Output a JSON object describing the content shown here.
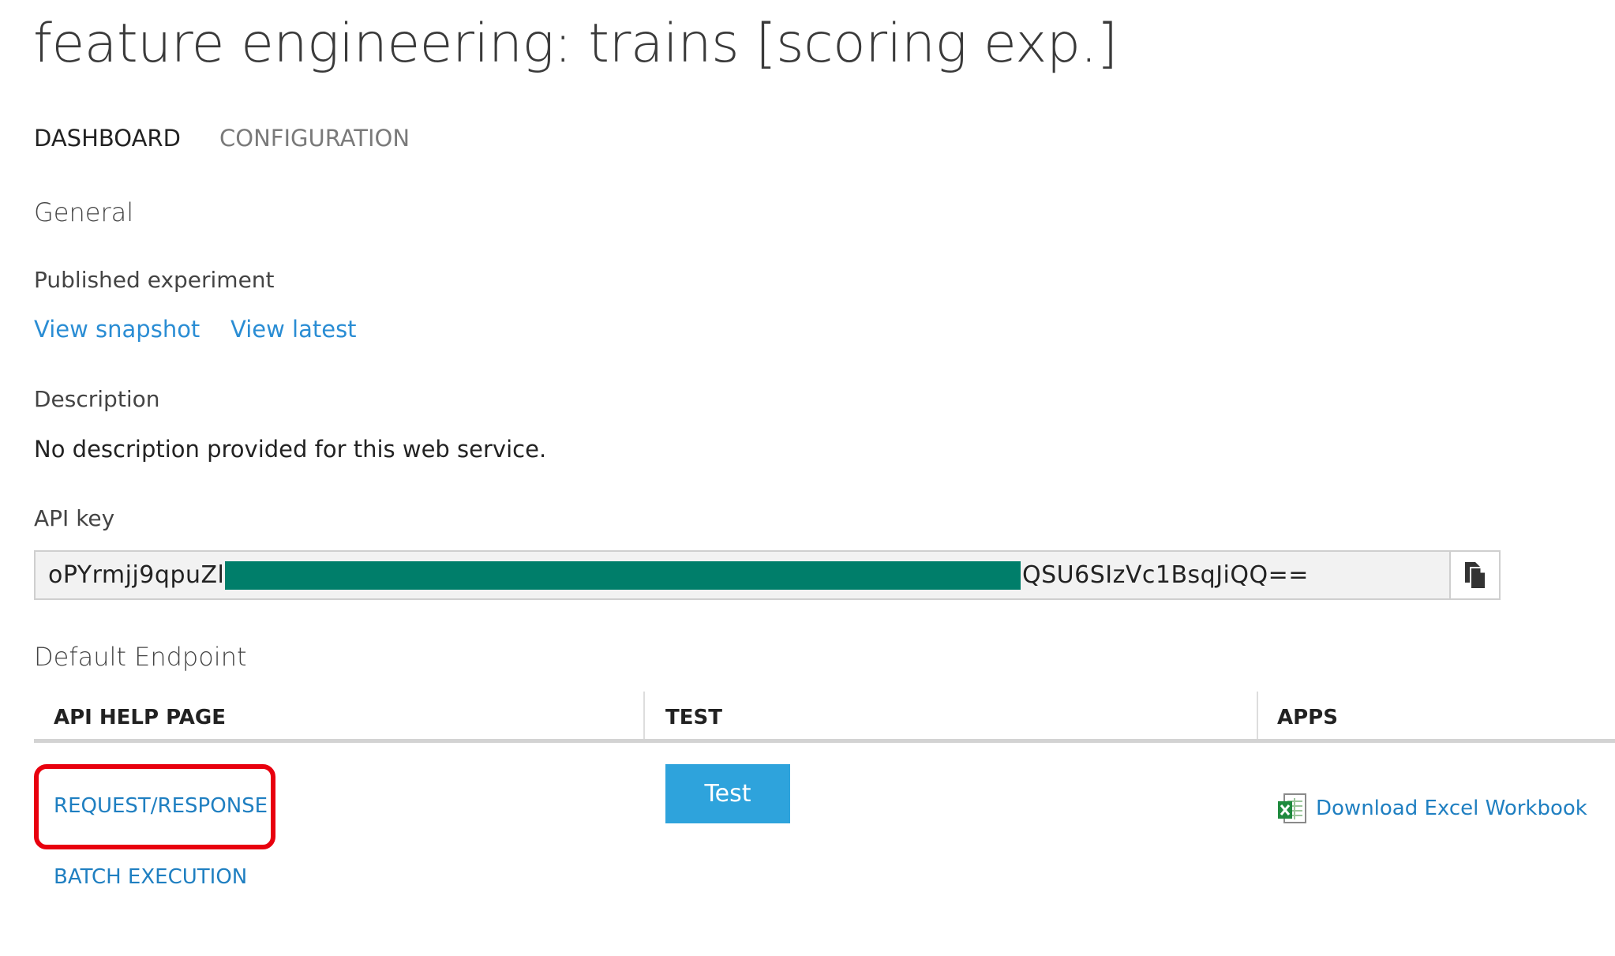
{
  "page": {
    "title": "feature engineering: trains [scoring exp.]"
  },
  "tabs": [
    {
      "label": "DASHBOARD",
      "active": true
    },
    {
      "label": "CONFIGURATION",
      "active": false
    }
  ],
  "general": {
    "heading": "General",
    "published_label": "Published experiment",
    "view_snapshot": "View snapshot",
    "view_latest": "View latest",
    "description_label": "Description",
    "description_value": "No description provided for this web service.",
    "api_key_label": "API key",
    "api_key_visible_start": "oPYrmjj9qpuZlg",
    "api_key_visible_end": "QSU6SIzVc1BsqJiQQ=="
  },
  "endpoint": {
    "heading": "Default Endpoint",
    "columns": [
      "API HELP PAGE",
      "TEST",
      "APPS"
    ],
    "request_response": "REQUEST/RESPONSE",
    "batch_execution": "BATCH EXECUTION",
    "test_button": "Test",
    "excel_link": "Download Excel Workbook"
  },
  "colors": {
    "link": "#2a8dd4",
    "test_button": "#2ea3dc",
    "highlight": "#e8000e",
    "redaction": "#007e6a"
  },
  "icons": {
    "copy": "copy-icon",
    "excel": "excel-icon"
  }
}
